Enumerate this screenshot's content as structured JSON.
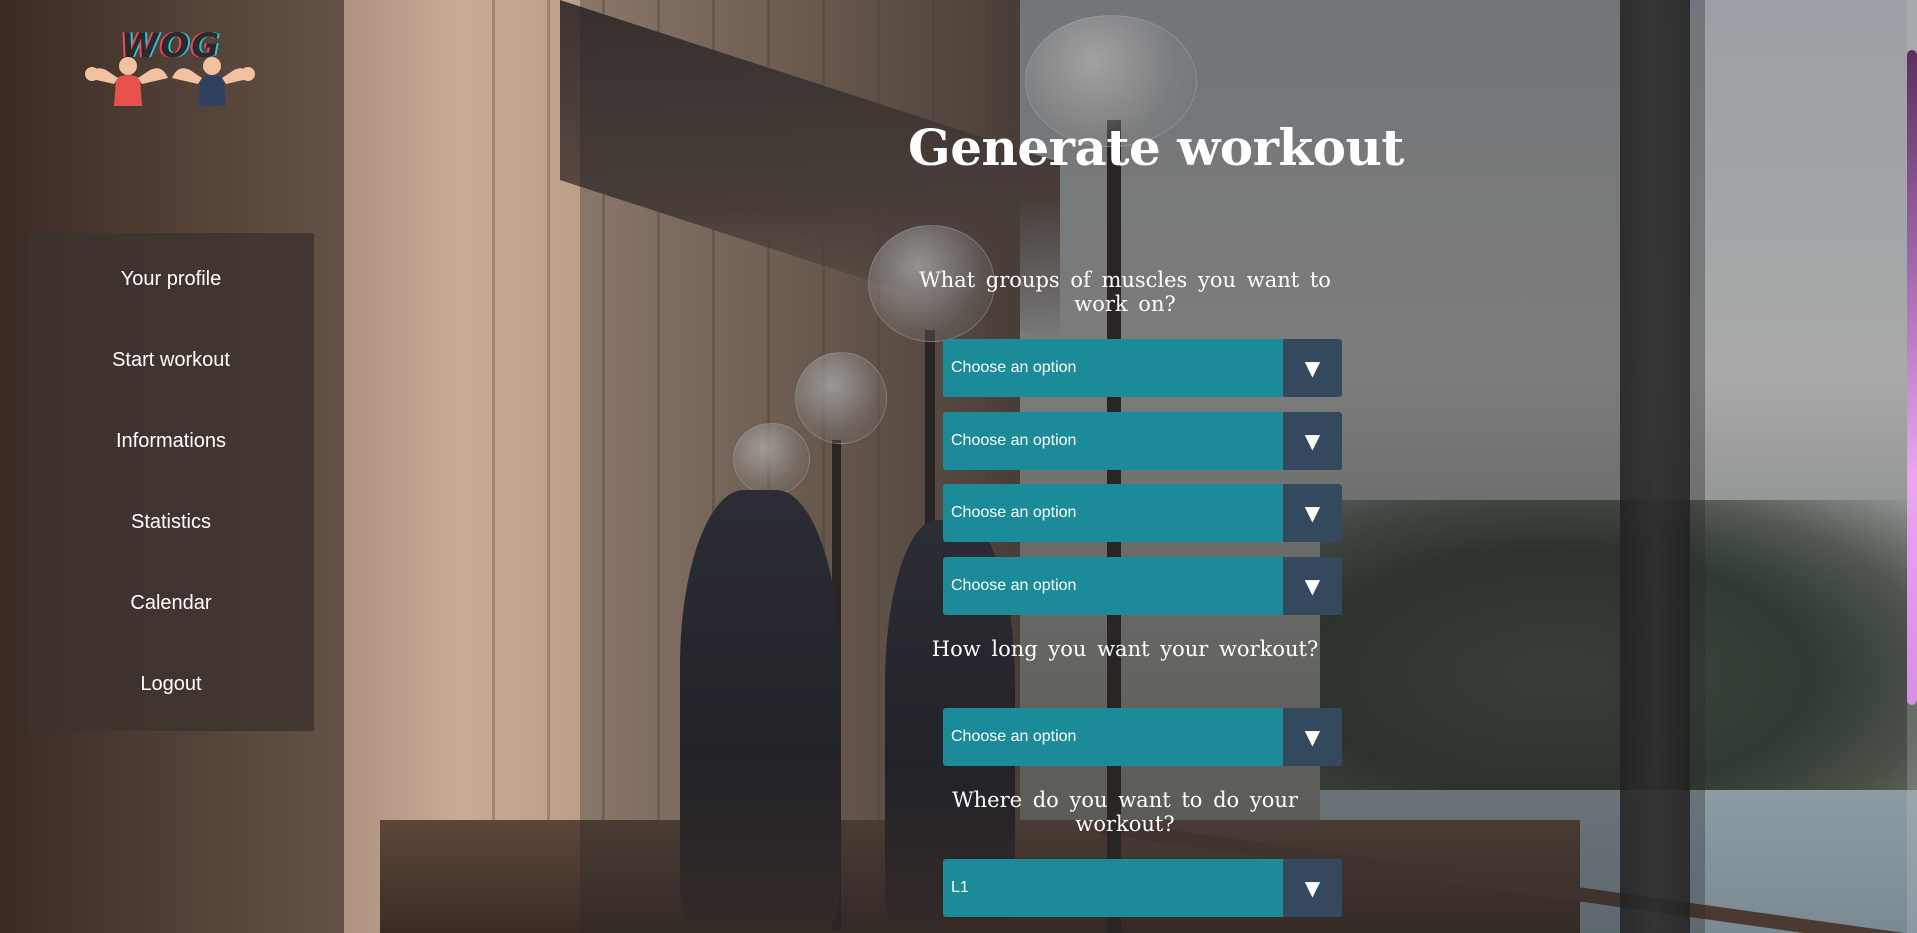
{
  "logo": {
    "text": "WOG"
  },
  "sidebar": {
    "items": [
      {
        "label": "Your profile"
      },
      {
        "label": "Start workout"
      },
      {
        "label": "Informations"
      },
      {
        "label": "Statistics"
      },
      {
        "label": "Calendar"
      },
      {
        "label": "Logout"
      }
    ]
  },
  "main": {
    "title": "Generate workout",
    "muscles": {
      "question": "What groups of muscles you want to work on?",
      "selects": [
        {
          "value": "Choose an option"
        },
        {
          "value": "Choose an option"
        },
        {
          "value": "Choose an option"
        },
        {
          "value": "Choose an option"
        }
      ]
    },
    "duration": {
      "question": "How long you want your workout?",
      "select": {
        "value": "Choose an option"
      }
    },
    "location": {
      "question": "Where do you want to do your workout?",
      "select": {
        "value": "L1"
      }
    },
    "select_arrow": "▼"
  },
  "colors": {
    "select_bg": "#1b8a99",
    "select_arrow_bg": "#34495e",
    "sidebar_bg": "#3c322d"
  },
  "icons": [
    "logo-icon",
    "chevron-down-icon"
  ]
}
